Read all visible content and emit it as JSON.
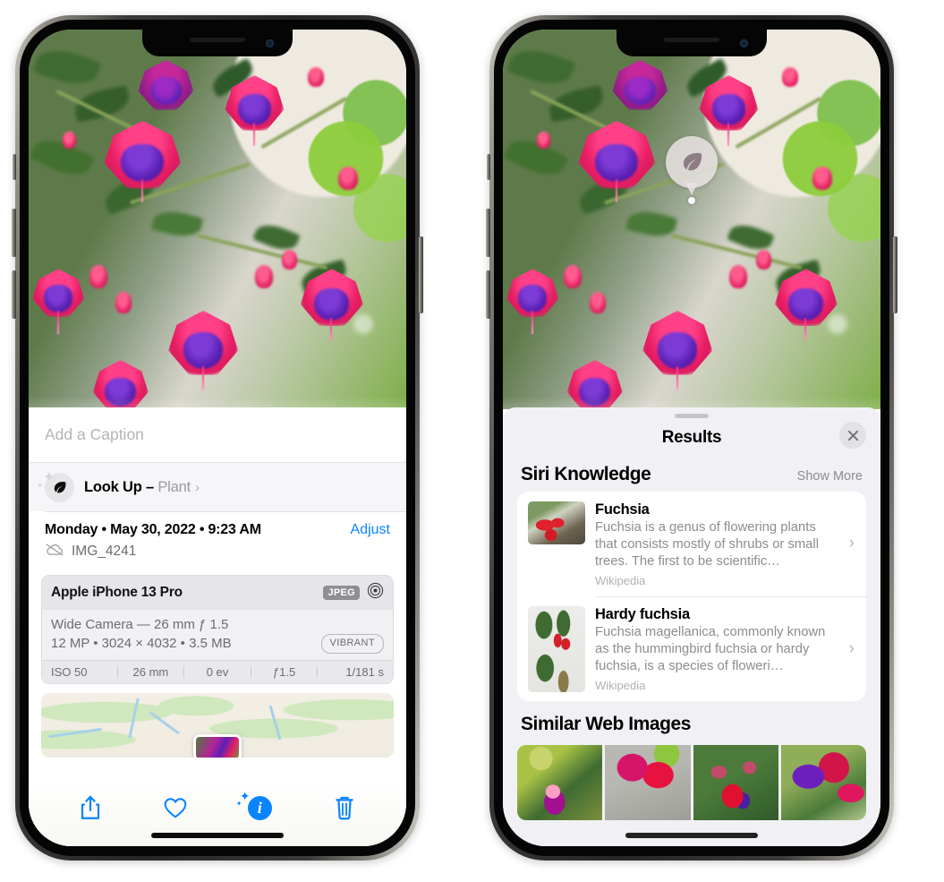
{
  "left_phone": {
    "caption_field": {
      "placeholder": "Add a Caption",
      "value": ""
    },
    "lookup_row": {
      "label": "Look Up – ",
      "subject": "Plant",
      "chevron": "›",
      "icon": "leaf-icon"
    },
    "metadata": {
      "date_line": "Monday • May 30, 2022 • 9:23 AM",
      "adjust_label": "Adjust",
      "filename": "IMG_4241",
      "cloud_icon": "icloud-slash-icon"
    },
    "camera_card": {
      "device": "Apple iPhone 13 Pro",
      "format_badge": "JPEG",
      "lens_icon": "aperture-icon",
      "lens_line": "Wide Camera — 26 mm ƒ 1.5",
      "spec_line": "12 MP • 3024 × 4032 • 3.5 MB",
      "style_badge": "VIBRANT",
      "exif": [
        "ISO 50",
        "26 mm",
        "0 ev",
        "ƒ1.5",
        "1/181 s"
      ]
    },
    "toolbar": [
      {
        "name": "share-button",
        "icon": "share-icon"
      },
      {
        "name": "favorite-button",
        "icon": "heart-icon"
      },
      {
        "name": "info-button",
        "icon": "info-sparkle-icon"
      },
      {
        "name": "delete-button",
        "icon": "trash-icon"
      }
    ]
  },
  "right_phone": {
    "photo_badge": {
      "icon": "leaf-icon"
    },
    "sheet": {
      "title": "Results",
      "close_icon": "close-icon"
    },
    "siri_knowledge": {
      "section_title": "Siri Knowledge",
      "show_more": "Show More",
      "items": [
        {
          "title": "Fuchsia",
          "description": "Fuchsia is a genus of flowering plants that consists mostly of shrubs or small trees. The first to be scientific…",
          "source": "Wikipedia",
          "chevron": "›"
        },
        {
          "title": "Hardy fuchsia",
          "description": "Fuchsia magellanica, commonly known as the hummingbird fuchsia or hardy fuchsia, is a species of floweri…",
          "source": "Wikipedia",
          "chevron": "›"
        }
      ]
    },
    "similar_web_images": {
      "section_title": "Similar Web Images",
      "thumbnails": [
        "fuchsia-pink-white",
        "fuchsia-red-closeup",
        "fuchsia-bush",
        "fuchsia-purple-red"
      ]
    }
  },
  "colors": {
    "accent_blue": "#0a84ff",
    "sheet_gray": "#f1f1f5",
    "secondary_text": "#8c8c92"
  }
}
